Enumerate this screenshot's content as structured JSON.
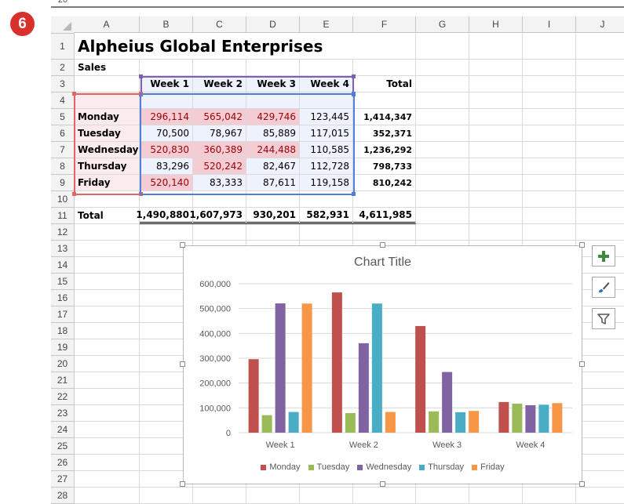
{
  "step_number": "6",
  "sheet": {
    "prev_row_number": "20",
    "columns": [
      "A",
      "B",
      "C",
      "D",
      "E",
      "F",
      "G",
      "H",
      "I",
      "J"
    ],
    "row_numbers": [
      "1",
      "2",
      "3",
      "4",
      "5",
      "6",
      "7",
      "8",
      "9",
      "10",
      "11",
      "12",
      "13",
      "14",
      "15",
      "16",
      "17",
      "18",
      "19",
      "20",
      "21",
      "22",
      "23",
      "24",
      "25",
      "26",
      "27",
      "28"
    ],
    "title": "Alpheius Global Enterprises",
    "subtitle": "Sales",
    "headers": [
      "Week 1",
      "Week 2",
      "Week 3",
      "Week 4",
      "Total"
    ],
    "rows": [
      {
        "day": "Monday",
        "values": [
          "296,114",
          "565,042",
          "429,746",
          "123,445"
        ],
        "total": "1,414,347"
      },
      {
        "day": "Tuesday",
        "values": [
          "70,500",
          "78,967",
          "85,889",
          "117,015"
        ],
        "total": "352,371"
      },
      {
        "day": "Wednesday",
        "values": [
          "520,830",
          "360,389",
          "244,488",
          "110,585"
        ],
        "total": "1,236,292"
      },
      {
        "day": "Thursday",
        "values": [
          "83,296",
          "520,242",
          "82,467",
          "112,728"
        ],
        "total": "798,733"
      },
      {
        "day": "Friday",
        "values": [
          "520,140",
          "83,333",
          "87,611",
          "119,158"
        ],
        "total": "810,242"
      }
    ],
    "total_label": "Total",
    "totals": [
      "1,490,880",
      "1,607,973",
      "930,201",
      "582,931",
      "4,611,985"
    ]
  },
  "chart_data": {
    "type": "bar",
    "title": "Chart Title",
    "categories": [
      "Week 1",
      "Week 2",
      "Week 3",
      "Week 4"
    ],
    "series": [
      {
        "name": "Monday",
        "color": "#c0504d",
        "values": [
          296114,
          565042,
          429746,
          123445
        ]
      },
      {
        "name": "Tuesday",
        "color": "#9bbb59",
        "values": [
          70500,
          78967,
          85889,
          117015
        ]
      },
      {
        "name": "Wednesday",
        "color": "#8064a2",
        "values": [
          520830,
          360389,
          244488,
          110585
        ]
      },
      {
        "name": "Thursday",
        "color": "#4bacc6",
        "values": [
          83296,
          520242,
          82467,
          112728
        ]
      },
      {
        "name": "Friday",
        "color": "#f79646",
        "values": [
          520140,
          83333,
          87611,
          119158
        ]
      }
    ],
    "ylim": [
      0,
      600000
    ],
    "yticks": [
      "0",
      "100,000",
      "200,000",
      "300,000",
      "400,000",
      "500,000",
      "600,000"
    ],
    "grid": true,
    "legend_position": "bottom"
  },
  "chart_tools": {
    "elements_icon": "plus-icon",
    "styles_icon": "paintbrush-icon",
    "filters_icon": "filter-icon"
  }
}
